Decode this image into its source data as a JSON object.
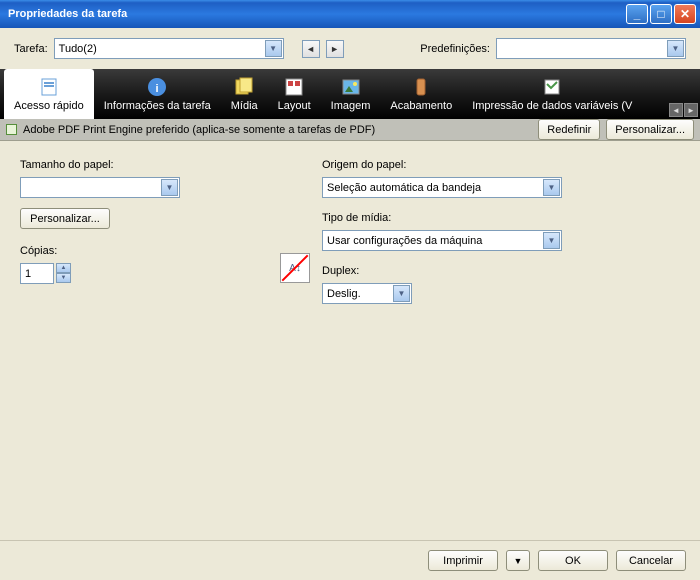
{
  "window": {
    "title": "Propriedades da tarefa"
  },
  "toprow": {
    "tarefa_label": "Tarefa:",
    "tarefa_value": "Tudo(2)",
    "predef_label": "Predefinições:",
    "predef_value": ""
  },
  "tabs": [
    {
      "label": "Acesso rápido",
      "icon": "doc-icon"
    },
    {
      "label": "Informações da tarefa",
      "icon": "info-icon"
    },
    {
      "label": "Mídia",
      "icon": "media-icon"
    },
    {
      "label": "Layout",
      "icon": "layout-icon"
    },
    {
      "label": "Imagem",
      "icon": "image-icon"
    },
    {
      "label": "Acabamento",
      "icon": "finish-icon"
    },
    {
      "label": "Impressão de dados variáveis (V",
      "icon": "vdp-icon"
    }
  ],
  "subbar": {
    "text": "Adobe PDF Print Engine preferido (aplica-se somente a tarefas de PDF)",
    "redefine": "Redefinir",
    "personalize": "Personalizar..."
  },
  "fields": {
    "tamanho_label": "Tamanho do papel:",
    "tamanho_value": "",
    "personalizar_btn": "Personalizar...",
    "copias_label": "Cópias:",
    "copias_value": "1",
    "origem_label": "Origem do papel:",
    "origem_value": "Seleção automática da bandeja",
    "tipo_label": "Tipo de mídia:",
    "tipo_value": "Usar configurações da máquina",
    "duplex_label": "Duplex:",
    "duplex_value": "Deslig."
  },
  "footer": {
    "imprimir": "Imprimir",
    "ok": "OK",
    "cancelar": "Cancelar"
  }
}
